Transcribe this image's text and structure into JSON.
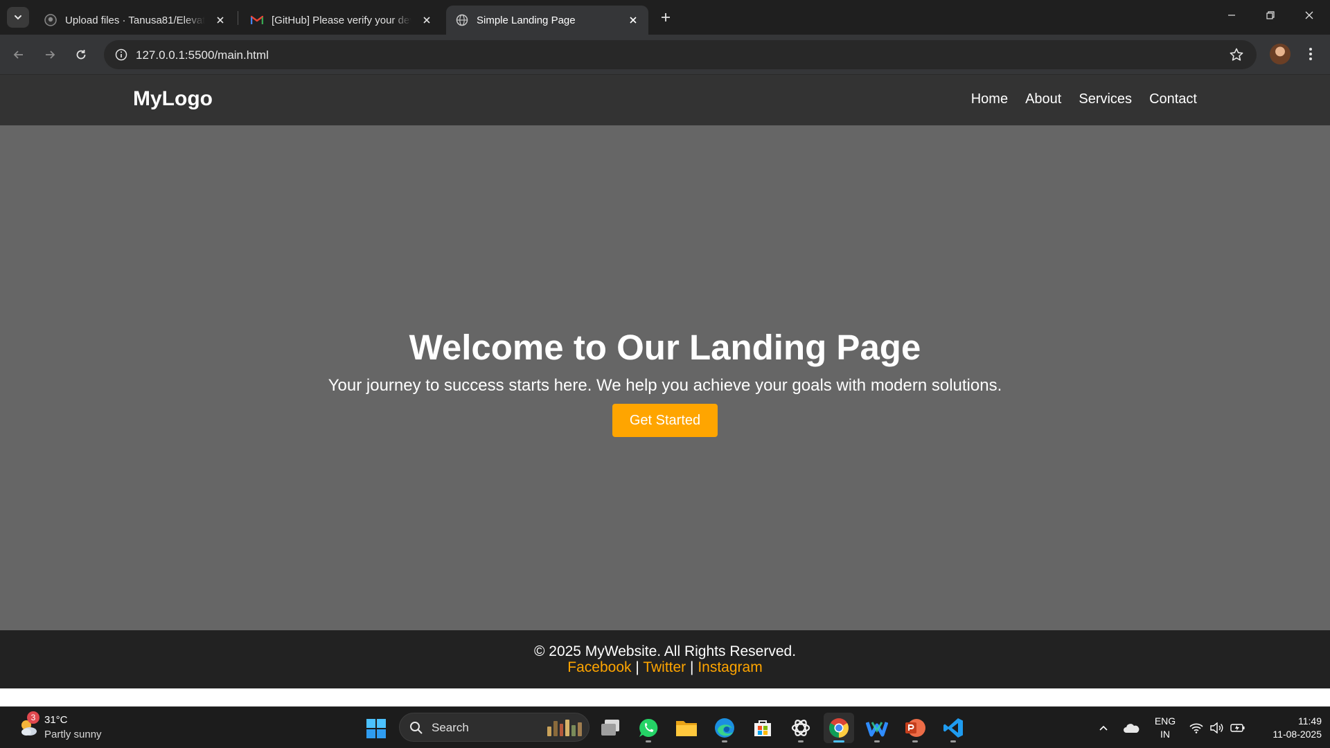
{
  "browser": {
    "tabs": [
      {
        "title": "Upload files · Tanusa81/Elevate-",
        "icon": "github-icon",
        "active": false
      },
      {
        "title": "[GitHub] Please verify your devi",
        "icon": "gmail-icon",
        "active": false
      },
      {
        "title": "Simple Landing Page",
        "icon": "globe-icon",
        "active": true
      }
    ],
    "url": "127.0.0.1:5500/main.html"
  },
  "site": {
    "logo": "MyLogo",
    "nav": [
      "Home",
      "About",
      "Services",
      "Contact"
    ],
    "hero": {
      "title": "Welcome to Our Landing Page",
      "subtitle": "Your journey to success starts here. We help you achieve your goals with modern solutions.",
      "cta": "Get Started"
    },
    "footer": {
      "copyright": "© 2025 MyWebsite. All Rights Reserved.",
      "links": [
        "Facebook",
        "Twitter",
        "Instagram"
      ],
      "separator": "|"
    },
    "colors": {
      "header": "#333333",
      "hero": "#666666",
      "footer": "#222222",
      "accent": "#ffa500"
    }
  },
  "taskbar": {
    "weather": {
      "badge": "3",
      "temp": "31°C",
      "desc": "Partly sunny"
    },
    "search_label": "Search",
    "apps": [
      "task-view-icon",
      "whatsapp-icon",
      "file-explorer-icon",
      "edge-icon",
      "microsoft-store-icon",
      "chatgpt-icon",
      "chrome-icon",
      "webex-icon",
      "powerpoint-icon",
      "vscode-icon"
    ],
    "active_app": "chrome-icon",
    "lang": {
      "line1": "ENG",
      "line2": "IN"
    },
    "clock": {
      "time": "11:49",
      "date": "11-08-2025"
    }
  }
}
